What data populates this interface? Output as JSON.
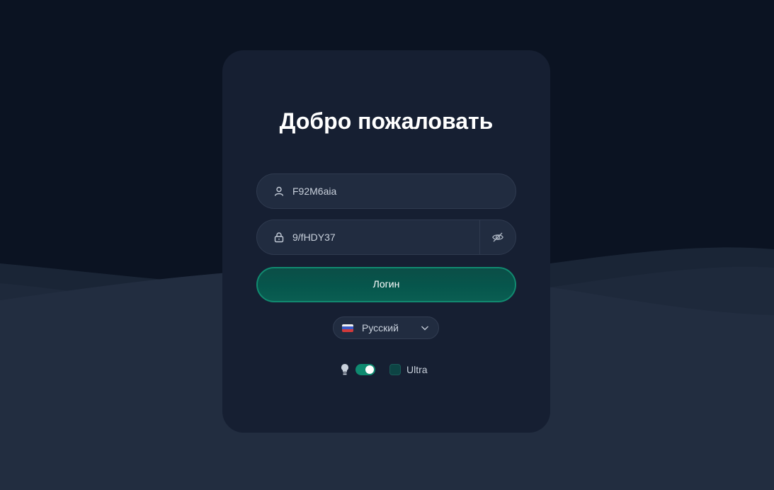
{
  "page": {
    "title": "Добро пожаловать"
  },
  "login_form": {
    "username": {
      "value": "F92M6aia",
      "icon": "user-icon"
    },
    "password": {
      "value": "9/fHDY37",
      "icon": "lock-icon",
      "toggle_icon": "eye-off-icon"
    },
    "submit_label": "Логин"
  },
  "language": {
    "selected": "Русский",
    "flag": "russia-flag-icon",
    "chevron": "chevron-down-icon"
  },
  "options": {
    "theme_toggle_on": true,
    "bulb_icon": "lightbulb-icon",
    "ultra_label": "Ultra",
    "ultra_checked": false
  },
  "colors": {
    "background": "#0b1322",
    "card": "#161f32",
    "field": "#212c40",
    "accent": "#0f8a70",
    "button": "#06564c"
  }
}
